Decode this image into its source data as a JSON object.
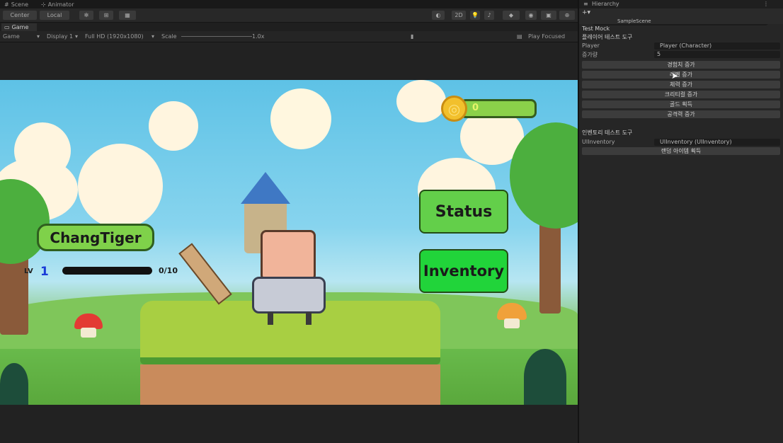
{
  "editor": {
    "tabs": {
      "scene": "Scene",
      "animator": "Animator"
    },
    "toolbar": {
      "center_label": "Center",
      "local_label": "Local",
      "two_d_label": "2D"
    },
    "game": {
      "tab_label": "Game",
      "display_mode": "Game",
      "display": "Display 1",
      "resolution": "Full HD (1920x1080)",
      "scale_label": "Scale",
      "scale_value": "1.0x",
      "play_focused": "Play Focused"
    }
  },
  "game_ui": {
    "player_name": "ChangTiger",
    "level_label": "LV",
    "level_value": "1",
    "exp_text": "0/10",
    "gold_value": "0",
    "status_button": "Status",
    "inventory_button": "Inventory"
  },
  "inspector": {
    "hierarchy_tab": "Hierarchy",
    "hierarchy_item": "SampleScene",
    "component_title": "Test Mock",
    "player_section": "플레이어 테스트 도구",
    "player_label": "Player",
    "player_value": "Player (Character)",
    "amount_label": "증가량",
    "amount_value": "5",
    "player_buttons": [
      "경험치 증가",
      "레벨 증가",
      "체력 증가",
      "크리티컬 증가",
      "골드 획득",
      "공격력 증가"
    ],
    "inventory_section": "인벤토리 테스트 도구",
    "inventory_label": "UIInventory",
    "inventory_value": "UIInventory (UIInventory)",
    "inventory_button": "랜덤 아이템 획득"
  }
}
